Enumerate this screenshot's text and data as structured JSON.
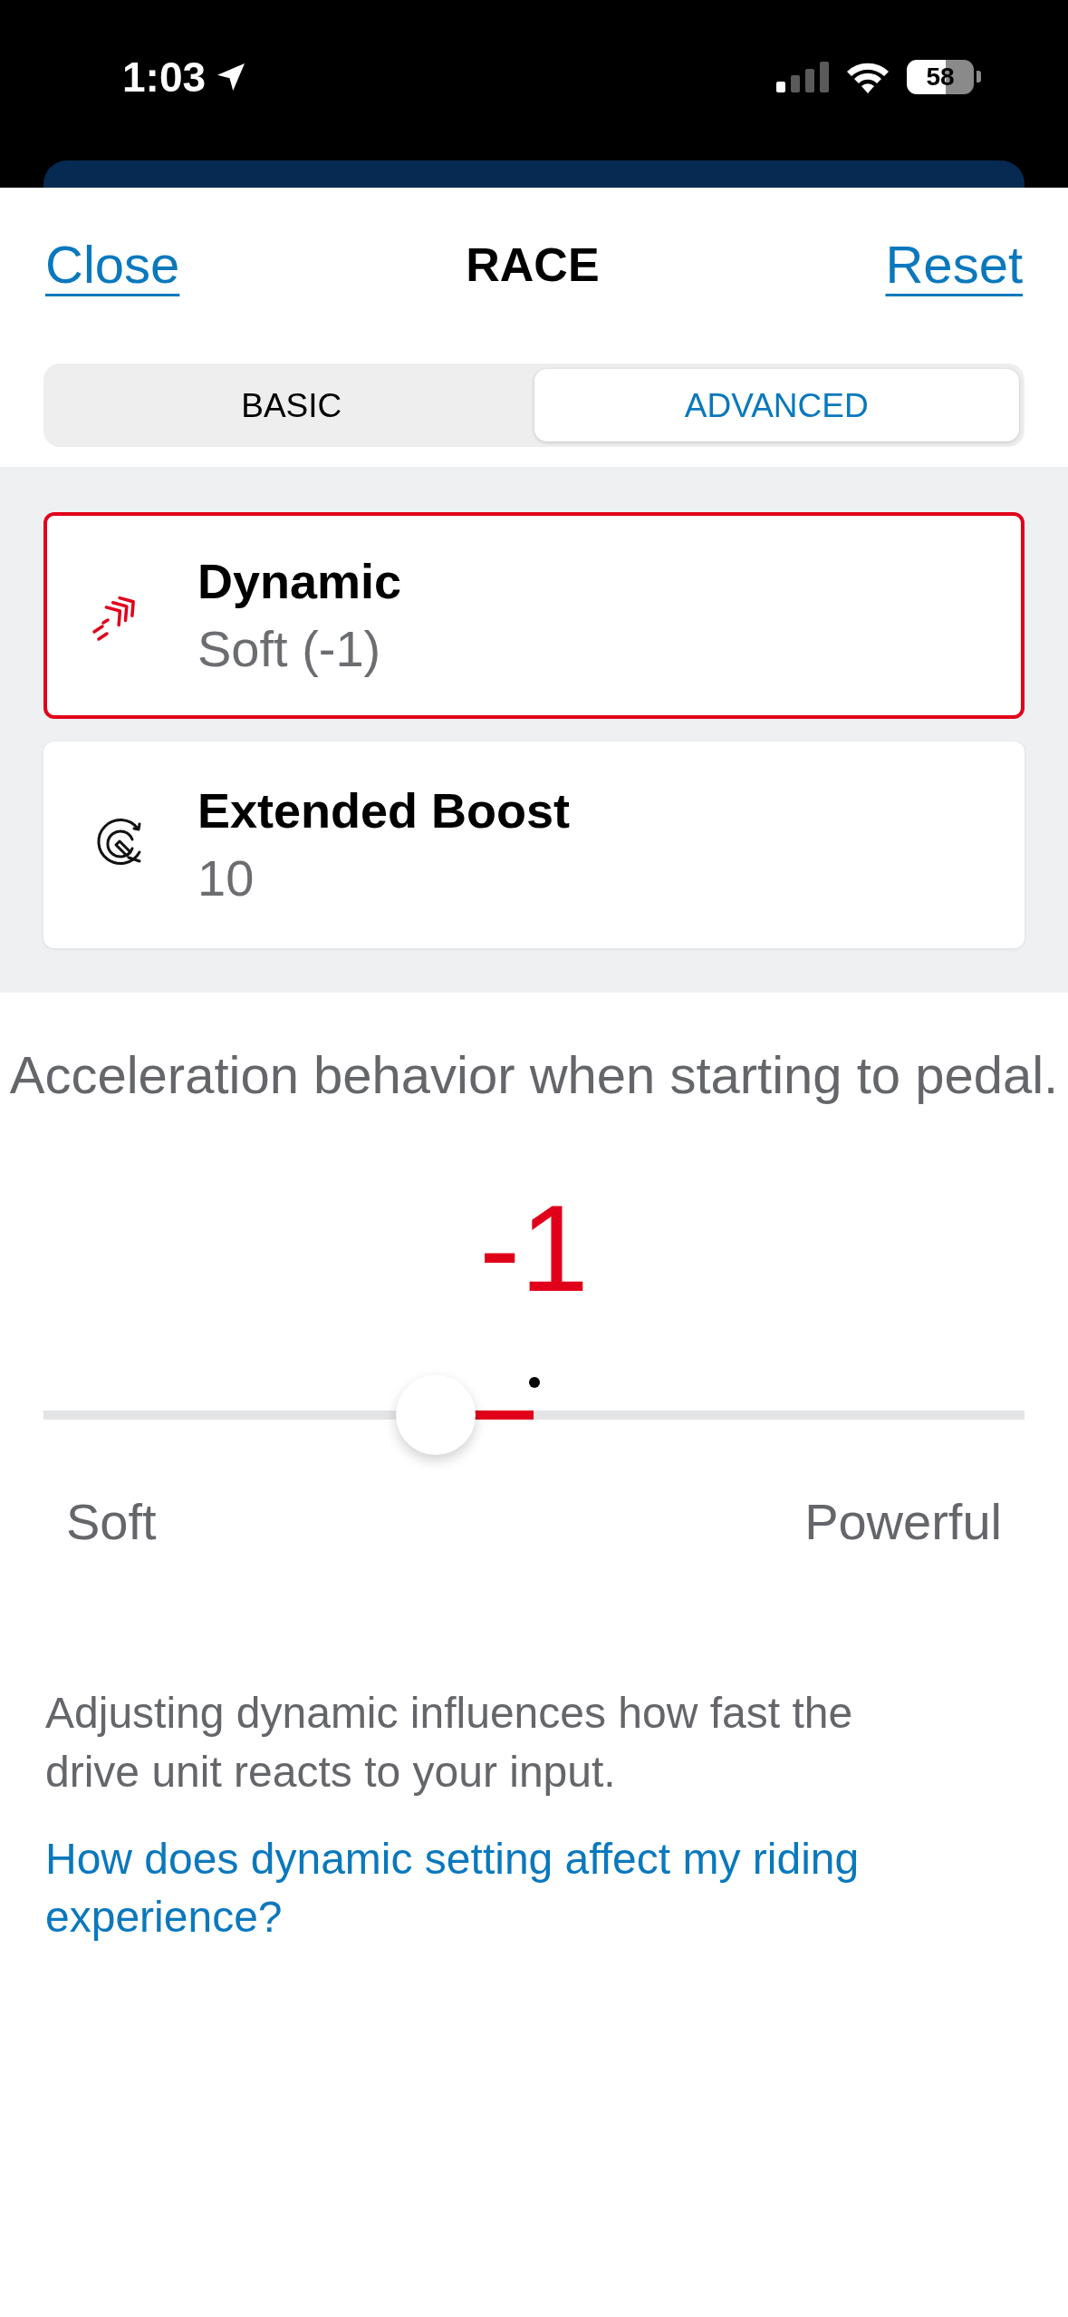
{
  "status_bar": {
    "time": "1:03",
    "battery": "58"
  },
  "header": {
    "close": "Close",
    "title": "RACE",
    "reset": "Reset"
  },
  "tabs": [
    {
      "label": "BASIC",
      "selected": false
    },
    {
      "label": "ADVANCED",
      "selected": true
    }
  ],
  "settings": [
    {
      "kind": "dynamic",
      "title": "Dynamic",
      "value": "Soft (-1)",
      "selected": true
    },
    {
      "kind": "boost",
      "title": "Extended Boost",
      "value": "10",
      "selected": false
    }
  ],
  "detail": {
    "description": "Acceleration behavior when starting to pedal.",
    "value": "-1",
    "slider": {
      "level": 0.4
    },
    "min_label": "Soft",
    "max_label": "Powerful"
  },
  "help": {
    "text": "Adjusting dynamic influences how fast the drive unit reacts to your input.",
    "link": "How does dynamic setting affect my riding experience?"
  }
}
